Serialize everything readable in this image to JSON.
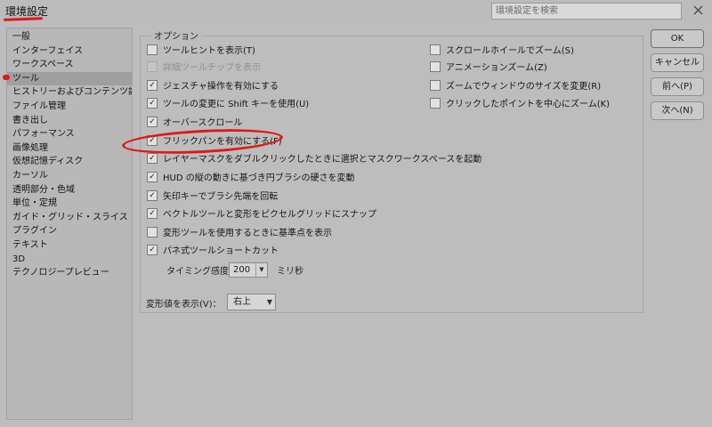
{
  "window": {
    "title": "環境設定",
    "close_icon": "close-icon"
  },
  "search": {
    "placeholder": "環境設定を検索"
  },
  "sidebar": {
    "items": [
      "一般",
      "インターフェイス",
      "ワークスペース",
      "ツール",
      "ヒストリーおよびコンテンツ認証情報",
      "ファイル管理",
      "書き出し",
      "パフォーマンス",
      "画像処理",
      "仮想記憶ディスク",
      "カーソル",
      "透明部分・色域",
      "単位・定規",
      "ガイド・グリッド・スライス",
      "プラグイン",
      "テキスト",
      "3D",
      "テクノロジープレビュー"
    ],
    "selected_index": 3
  },
  "options": {
    "group_label": "オプション",
    "left": [
      {
        "label": "ツールヒントを表示(T)",
        "checked": false,
        "disabled": false
      },
      {
        "label": "詳細ツールチップを表示",
        "checked": false,
        "disabled": true
      },
      {
        "label": "ジェスチャ操作を有効にする",
        "checked": true,
        "disabled": false
      },
      {
        "label": "ツールの変更に Shift キーを使用(U)",
        "checked": true,
        "disabled": false
      },
      {
        "label": "オーバースクロール",
        "checked": true,
        "disabled": false
      },
      {
        "label": "フリックパンを有効にする(F)",
        "checked": true,
        "disabled": false
      },
      {
        "label": "レイヤーマスクをダブルクリックしたときに選択とマスクワークスペースを起動",
        "checked": true,
        "disabled": false
      },
      {
        "label": "HUD の縦の動きに基づき円ブラシの硬さを変動",
        "checked": true,
        "disabled": false
      },
      {
        "label": "矢印キーでブラシ先端を回転",
        "checked": true,
        "disabled": false
      },
      {
        "label": "ベクトルツールと変形をピクセルグリッドにスナップ",
        "checked": true,
        "disabled": false
      },
      {
        "label": "変形ツールを使用するときに基準点を表示",
        "checked": false,
        "disabled": false
      },
      {
        "label": "パネ式ツールショートカット",
        "checked": true,
        "disabled": false
      }
    ],
    "right": [
      {
        "label": "スクロールホイールでズーム(S)",
        "checked": false
      },
      {
        "label": "アニメーションズーム(Z)",
        "checked": false
      },
      {
        "label": "ズームでウィンドウのサイズを変更(R)",
        "checked": false
      },
      {
        "label": "クリックしたポイントを中心にズーム(K)",
        "checked": false
      }
    ],
    "timing": {
      "label": "タイミング感度：",
      "value": "200",
      "unit": "ミリ秒"
    },
    "transform_display": {
      "label": "変形値を表示(V)：",
      "value": "右上"
    }
  },
  "buttons": {
    "ok": "OK",
    "cancel": "キャンセル",
    "prev": "前へ(P)",
    "next": "次へ(N)"
  }
}
